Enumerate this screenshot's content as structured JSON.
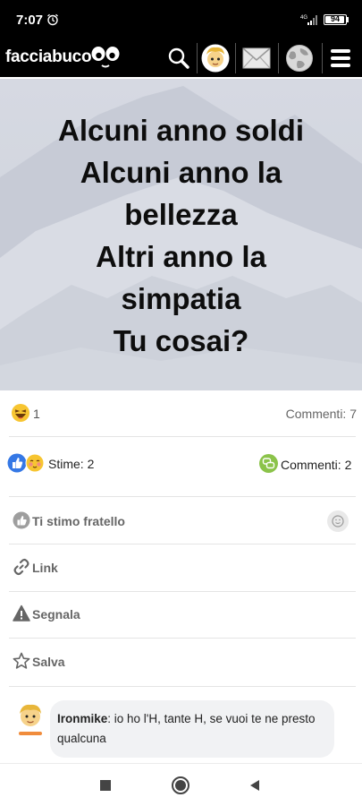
{
  "status_bar": {
    "time": "7:07",
    "network": "4G",
    "battery": "94",
    "battery_level": 0.94
  },
  "header": {
    "brand": "facciabuco",
    "icons": [
      "logo-eyes-icon",
      "search-icon",
      "user-avatar",
      "mail-icon",
      "globe-icon",
      "menu-icon"
    ]
  },
  "post": {
    "image_lines": [
      "Alcuni anno soldi",
      "Alcuni anno la",
      "bellezza",
      "Altri anno la",
      "simpatia",
      "Tu cosai?"
    ],
    "laugh_count": "1",
    "comments_count": "Commenti: 7",
    "stime": "Stime: 2",
    "commenti": "Commenti: 2"
  },
  "actions": {
    "stimo": "Ti stimo fratello",
    "link": "Link",
    "segnala": "Segnala",
    "salva": "Salva"
  },
  "comment": {
    "author": "Ironmike",
    "text": ": io ho l'H, tante H, se vuoi te ne presto qualcuna"
  },
  "colors": {
    "header_bg": "#000000",
    "like_blue": "#3578e5",
    "comment_green": "#8bc34a"
  }
}
